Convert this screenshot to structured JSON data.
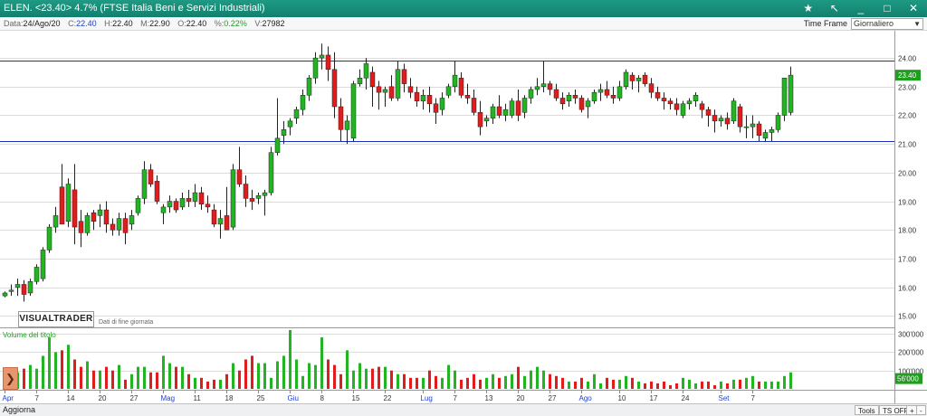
{
  "header": {
    "title": "ELEN. <23.40> 4.7%  (FTSE Italia Beni e Servizi Industriali)",
    "icons": [
      "star-icon",
      "pointer-icon",
      "minimize-icon",
      "restore-icon",
      "close-icon"
    ]
  },
  "infobar": {
    "data_label": "Data:",
    "data_value": "24/Ago/20",
    "c_label": "C:",
    "c_value": "22.40",
    "h_label": "H:",
    "h_value": "22.40",
    "m_label": "M:",
    "m_value": "22.90",
    "o_label": "O:",
    "o_value": "22.40",
    "pct_label": "%:",
    "pct_value": "0.22%",
    "vol_label": "V:",
    "vol_value": "27982"
  },
  "timeframe": {
    "label": "Time Frame",
    "value": "Giornaliero"
  },
  "logo": {
    "text": "VISUALTRADER",
    "note": "Dati di fine giornata"
  },
  "volume_label": "Volume del titolo",
  "bottom": {
    "aggiorna": "Aggiorna",
    "tools": "Tools",
    "tsoff": "TS OFF",
    "plus": "+",
    "minus": "-"
  },
  "colors": {
    "up": "#22b422",
    "down": "#e01c1c",
    "hline": "#1b2fbf",
    "title_bg": "#11806d"
  },
  "chart_data": {
    "type": "candlestick",
    "price_ticks": [
      "15.00",
      "16.00",
      "17.00",
      "18.00",
      "19.00",
      "20.00",
      "21.00",
      "22.00",
      "23.00",
      "24.00"
    ],
    "ylim": [
      14.6,
      24.95
    ],
    "last_price_label": "23.40",
    "horizontal_lines": [
      23.9,
      21.1
    ],
    "volume_ticks": [
      "100'000",
      "200'000",
      "300'000"
    ],
    "volume_ylim": [
      0,
      320000
    ],
    "volume_tag": "56'000",
    "x_labels": [
      {
        "label": "Apr",
        "i": 0
      },
      {
        "label": "7",
        "i": 5
      },
      {
        "label": "14",
        "i": 10
      },
      {
        "label": "20",
        "i": 15
      },
      {
        "label": "27",
        "i": 20
      },
      {
        "label": "Mag",
        "i": 25
      },
      {
        "label": "11",
        "i": 30
      },
      {
        "label": "18",
        "i": 35
      },
      {
        "label": "25",
        "i": 40
      },
      {
        "label": "Giu",
        "i": 45
      },
      {
        "label": "8",
        "i": 50
      },
      {
        "label": "15",
        "i": 55
      },
      {
        "label": "22",
        "i": 60
      },
      {
        "label": "Lug",
        "i": 66
      },
      {
        "label": "7",
        "i": 71
      },
      {
        "label": "13",
        "i": 76
      },
      {
        "label": "20",
        "i": 81
      },
      {
        "label": "27",
        "i": 86
      },
      {
        "label": "Ago",
        "i": 91
      },
      {
        "label": "10",
        "i": 97
      },
      {
        "label": "17",
        "i": 102
      },
      {
        "label": "24",
        "i": 107
      },
      {
        "label": "Set",
        "i": 113
      },
      {
        "label": "7",
        "i": 118
      }
    ],
    "ohlc": [
      [
        15.7,
        15.85,
        15.65,
        15.8
      ],
      [
        15.85,
        16.1,
        15.7,
        15.9
      ],
      [
        16.0,
        16.3,
        15.7,
        16.1
      ],
      [
        16.1,
        16.25,
        15.5,
        15.75
      ],
      [
        15.8,
        16.3,
        15.7,
        16.2
      ],
      [
        16.2,
        16.8,
        16.1,
        16.7
      ],
      [
        16.3,
        17.4,
        16.2,
        17.3
      ],
      [
        17.3,
        18.2,
        17.2,
        18.1
      ],
      [
        18.1,
        18.8,
        17.9,
        18.5
      ],
      [
        19.5,
        20.3,
        18.9,
        18.2
      ],
      [
        18.3,
        19.8,
        18.1,
        19.6
      ],
      [
        19.4,
        20.3,
        17.5,
        18.1
      ],
      [
        18.3,
        18.7,
        17.4,
        17.9
      ],
      [
        17.9,
        18.6,
        17.8,
        18.5
      ],
      [
        18.6,
        18.7,
        18.0,
        18.3
      ],
      [
        18.5,
        18.9,
        18.1,
        18.7
      ],
      [
        18.7,
        19.0,
        17.9,
        18.2
      ],
      [
        18.2,
        18.4,
        17.8,
        18.0
      ],
      [
        18.0,
        18.6,
        17.8,
        18.4
      ],
      [
        18.4,
        18.6,
        17.5,
        17.9
      ],
      [
        18.2,
        18.7,
        18.0,
        18.5
      ],
      [
        18.6,
        19.2,
        18.5,
        19.1
      ],
      [
        19.1,
        20.4,
        18.9,
        20.1
      ],
      [
        20.1,
        20.3,
        19.5,
        19.6
      ],
      [
        19.7,
        19.9,
        18.9,
        19.0
      ],
      [
        18.6,
        18.9,
        18.2,
        18.8
      ],
      [
        18.8,
        19.2,
        18.6,
        19.0
      ],
      [
        19.0,
        19.1,
        18.6,
        18.7
      ],
      [
        18.8,
        19.3,
        18.7,
        19.1
      ],
      [
        19.1,
        19.4,
        18.8,
        19.0
      ],
      [
        19.0,
        19.6,
        18.8,
        19.3
      ],
      [
        19.3,
        19.5,
        18.7,
        18.9
      ],
      [
        18.9,
        19.2,
        18.6,
        18.8
      ],
      [
        18.7,
        18.9,
        18.1,
        18.2
      ],
      [
        18.2,
        18.7,
        17.7,
        18.4
      ],
      [
        18.5,
        19.5,
        18.4,
        18.0
      ],
      [
        18.1,
        20.3,
        18.0,
        20.1
      ],
      [
        20.1,
        20.9,
        19.5,
        19.6
      ],
      [
        19.6,
        19.9,
        18.8,
        19.1
      ],
      [
        19.1,
        19.4,
        18.7,
        19.0
      ],
      [
        19.1,
        19.3,
        18.9,
        19.2
      ],
      [
        19.2,
        19.4,
        18.5,
        19.3
      ],
      [
        19.3,
        20.9,
        19.2,
        20.7
      ],
      [
        20.7,
        22.6,
        20.6,
        21.2
      ],
      [
        21.3,
        21.8,
        21.0,
        21.5
      ],
      [
        21.6,
        21.9,
        21.3,
        21.8
      ],
      [
        21.9,
        22.3,
        21.7,
        22.2
      ],
      [
        22.2,
        22.9,
        22.0,
        22.7
      ],
      [
        22.7,
        23.4,
        22.5,
        23.3
      ],
      [
        23.3,
        24.2,
        23.1,
        24.0
      ],
      [
        24.0,
        24.5,
        23.6,
        24.1
      ],
      [
        24.1,
        24.4,
        23.2,
        23.6
      ],
      [
        23.6,
        24.2,
        21.9,
        22.3
      ],
      [
        22.3,
        22.6,
        21.1,
        21.5
      ],
      [
        21.5,
        22.0,
        21.0,
        21.8
      ],
      [
        21.2,
        23.2,
        21.1,
        23.1
      ],
      [
        23.1,
        23.6,
        23.0,
        23.3
      ],
      [
        23.3,
        24.0,
        22.9,
        23.8
      ],
      [
        23.5,
        23.7,
        22.3,
        23.0
      ],
      [
        23.0,
        23.2,
        22.2,
        22.8
      ],
      [
        22.8,
        23.0,
        22.3,
        22.9
      ],
      [
        23.0,
        23.4,
        22.5,
        22.6
      ],
      [
        22.6,
        23.9,
        22.5,
        23.6
      ],
      [
        23.6,
        23.8,
        22.8,
        23.1
      ],
      [
        23.0,
        23.3,
        22.6,
        22.8
      ],
      [
        22.8,
        23.0,
        22.3,
        22.5
      ],
      [
        22.5,
        22.9,
        22.2,
        22.7
      ],
      [
        22.7,
        23.0,
        22.1,
        22.4
      ],
      [
        22.4,
        22.6,
        21.7,
        22.1
      ],
      [
        22.2,
        22.8,
        22.0,
        22.6
      ],
      [
        22.7,
        23.1,
        22.6,
        23.0
      ],
      [
        23.0,
        23.9,
        22.8,
        23.4
      ],
      [
        23.3,
        23.5,
        22.6,
        22.7
      ],
      [
        22.7,
        23.1,
        22.4,
        22.6
      ],
      [
        22.6,
        22.9,
        22.0,
        22.1
      ],
      [
        22.1,
        22.5,
        21.3,
        21.6
      ],
      [
        21.8,
        22.0,
        21.6,
        21.9
      ],
      [
        21.9,
        22.4,
        21.7,
        22.3
      ],
      [
        22.3,
        22.7,
        21.9,
        22.0
      ],
      [
        22.0,
        22.4,
        21.8,
        22.2
      ],
      [
        22.0,
        22.6,
        21.9,
        22.5
      ],
      [
        22.5,
        22.9,
        21.8,
        22.0
      ],
      [
        22.1,
        22.7,
        21.9,
        22.6
      ],
      [
        22.6,
        23.0,
        22.4,
        22.9
      ],
      [
        22.9,
        23.3,
        22.7,
        23.0
      ],
      [
        23.0,
        23.9,
        22.8,
        23.1
      ],
      [
        23.1,
        23.2,
        22.7,
        22.9
      ],
      [
        22.9,
        23.1,
        22.5,
        22.6
      ],
      [
        22.6,
        22.8,
        22.2,
        22.4
      ],
      [
        22.5,
        22.8,
        22.3,
        22.7
      ],
      [
        22.7,
        22.9,
        22.4,
        22.6
      ],
      [
        22.6,
        22.7,
        22.1,
        22.2
      ],
      [
        22.3,
        22.6,
        21.9,
        22.5
      ],
      [
        22.5,
        22.9,
        22.4,
        22.8
      ],
      [
        22.8,
        23.1,
        22.5,
        22.9
      ],
      [
        22.9,
        23.2,
        22.6,
        22.7
      ],
      [
        22.7,
        23.0,
        22.4,
        22.6
      ],
      [
        22.6,
        23.2,
        22.5,
        23.0
      ],
      [
        23.0,
        23.6,
        22.9,
        23.5
      ],
      [
        23.4,
        23.5,
        22.9,
        23.2
      ],
      [
        23.2,
        23.4,
        22.8,
        23.3
      ],
      [
        23.4,
        23.5,
        23.0,
        23.1
      ],
      [
        23.1,
        23.3,
        22.6,
        22.8
      ],
      [
        22.8,
        23.0,
        22.5,
        22.6
      ],
      [
        22.6,
        22.8,
        22.2,
        22.5
      ],
      [
        22.5,
        22.6,
        22.2,
        22.4
      ],
      [
        22.4,
        22.6,
        22.0,
        22.2
      ],
      [
        22.0,
        22.5,
        21.9,
        22.4
      ],
      [
        22.4,
        22.6,
        22.2,
        22.5
      ],
      [
        22.5,
        22.8,
        22.3,
        22.7
      ],
      [
        22.4,
        22.5,
        21.9,
        22.2
      ],
      [
        22.2,
        22.3,
        21.6,
        22.0
      ],
      [
        22.0,
        22.2,
        21.4,
        21.8
      ],
      [
        21.8,
        22.0,
        21.6,
        21.9
      ],
      [
        21.9,
        22.1,
        21.5,
        21.7
      ],
      [
        21.8,
        22.6,
        21.7,
        22.5
      ],
      [
        22.3,
        22.4,
        21.4,
        21.6
      ],
      [
        21.6,
        22.0,
        21.2,
        21.6
      ],
      [
        21.6,
        22.0,
        21.2,
        21.7
      ],
      [
        21.7,
        21.8,
        21.1,
        21.3
      ],
      [
        21.2,
        21.5,
        21.1,
        21.4
      ],
      [
        21.4,
        21.6,
        21.1,
        21.5
      ],
      [
        21.5,
        22.1,
        21.4,
        22.0
      ],
      [
        22.0,
        23.0,
        21.8,
        23.3
      ],
      [
        22.1,
        23.7,
        22.0,
        23.4
      ]
    ],
    "volume": [
      0,
      60000,
      90000,
      110000,
      130000,
      110000,
      180000,
      280000,
      200000,
      210000,
      240000,
      160000,
      120000,
      150000,
      100000,
      100000,
      120000,
      100000,
      130000,
      50000,
      80000,
      120000,
      120000,
      90000,
      90000,
      180000,
      140000,
      120000,
      120000,
      80000,
      60000,
      60000,
      40000,
      50000,
      50000,
      80000,
      140000,
      100000,
      160000,
      180000,
      140000,
      140000,
      60000,
      150000,
      180000,
      320000,
      160000,
      70000,
      140000,
      130000,
      280000,
      160000,
      130000,
      80000,
      210000,
      100000,
      140000,
      110000,
      110000,
      120000,
      120000,
      100000,
      80000,
      80000,
      60000,
      60000,
      60000,
      100000,
      70000,
      60000,
      130000,
      100000,
      50000,
      60000,
      80000,
      50000,
      60000,
      80000,
      60000,
      70000,
      80000,
      120000,
      70000,
      100000,
      120000,
      100000,
      80000,
      70000,
      60000,
      40000,
      40000,
      60000,
      40000,
      80000,
      30000,
      60000,
      50000,
      50000,
      70000,
      60000,
      40000,
      30000,
      40000,
      30000,
      40000,
      20000,
      30000,
      60000,
      50000,
      30000,
      40000,
      40000,
      20000,
      40000,
      30000,
      50000,
      50000,
      60000,
      70000,
      40000,
      40000,
      40000,
      40000,
      70000,
      90000
    ]
  }
}
